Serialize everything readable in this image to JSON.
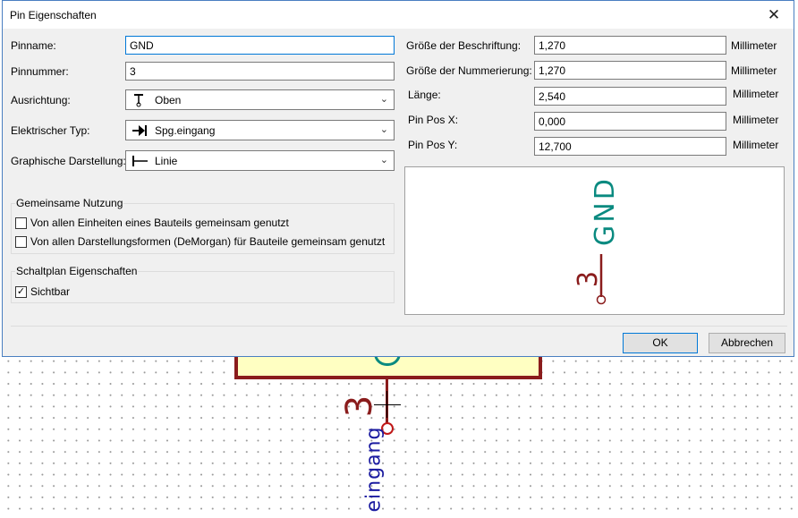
{
  "window": {
    "title": "Pin Eigenschaften",
    "close_glyph": "✕"
  },
  "left": {
    "pin_name_label": "Pinname:",
    "pin_name_value": "GND",
    "pin_number_label": "Pinnummer:",
    "pin_number_value": "3",
    "orientation_label": "Ausrichtung:",
    "orientation_value": "Oben",
    "orientation_icon": "pin-up-icon",
    "electrical_type_label": "Elektrischer Typ:",
    "electrical_type_value": "Spg.eingang",
    "electrical_type_icon": "power-input-icon",
    "graphic_style_label": "Graphische Darstellung:",
    "graphic_style_value": "Linie",
    "graphic_style_icon": "line-pin-icon"
  },
  "shared_group": {
    "title": "Gemeinsame Nutzung",
    "option_units": {
      "label": "Von allen Einheiten eines Bauteils gemeinsam genutzt",
      "checked": false
    },
    "option_demorgan": {
      "label": "Von allen Darstellungsformen (DeMorgan) für Bauteile gemeinsam genutzt",
      "checked": false
    }
  },
  "schematic_group": {
    "title": "Schaltplan Eigenschaften",
    "visible": {
      "label": "Sichtbar",
      "checked": true,
      "mark": "✓"
    }
  },
  "right": {
    "name_size_label": "Größe der Beschriftung:",
    "name_size_value": "1,270",
    "name_size_unit": "Millimeter",
    "number_size_label": "Größe der Nummerierung:",
    "number_size_value": "1,270",
    "number_size_unit": "Millimeter",
    "length_label": "Länge:",
    "length_value": "2,540",
    "length_unit": "Millimeter",
    "pos_x_label": "Pin Pos X:",
    "pos_x_value": "0,000",
    "pos_x_unit": "Millimeter",
    "pos_y_label": "Pin Pos Y:",
    "pos_y_value": "12,700",
    "pos_y_unit": "Millimeter"
  },
  "preview": {
    "pin_name": "GND",
    "pin_number": "3"
  },
  "buttons": {
    "ok": "OK",
    "cancel": "Abbrechen"
  },
  "background": {
    "pin_number": "3",
    "pin_name": "eingang"
  },
  "colors": {
    "pin_body": "#8a1c1c",
    "pin_name_text": "#0a8a80",
    "accent": "#0078d7",
    "part_fill": "#ffffc2"
  }
}
